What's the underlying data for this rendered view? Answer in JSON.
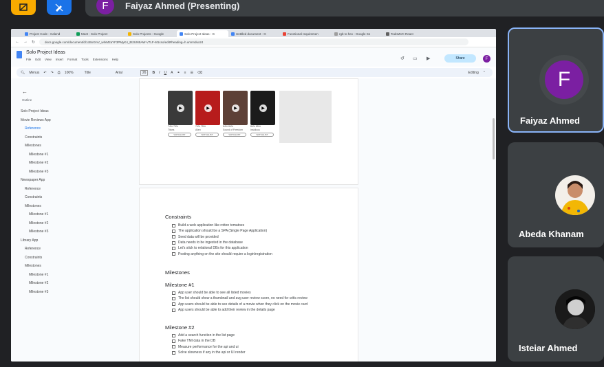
{
  "meet": {
    "presenter_initial": "F",
    "presenter_label": "Faiyaz Ahmed (Presenting)"
  },
  "browser": {
    "tabs": [
      {
        "title": "Project Code - Calend",
        "color": "#4285f4"
      },
      {
        "title": "Meet - Solo Project",
        "color": "#0f9d58"
      },
      {
        "title": "Solo Projects - Google",
        "color": "#f4b400"
      },
      {
        "title": "Solo Project Ideas - G",
        "color": "#4285f4",
        "active": true
      },
      {
        "title": "Untitled document - G",
        "color": "#4285f4"
      },
      {
        "title": "Functional requiremen",
        "color": "#ea4335"
      },
      {
        "title": "rgb to hex - Google Se",
        "color": "#9e9e9e"
      },
      {
        "title": "TodoMVC React",
        "color": "#616161"
      }
    ],
    "url": "docs.google.com/document/d/1cBxXmV_wrkM2aYF3PMyK4_BtJUNBAW-V7LF-M1cso/edit#heading=h.umnndux24"
  },
  "doc": {
    "title": "Solo Project Ideas",
    "menus": [
      "File",
      "Edit",
      "View",
      "Insert",
      "Format",
      "Tools",
      "Extensions",
      "Help"
    ],
    "share_label": "Share",
    "user_initial": "F",
    "toolbar": {
      "search": "Menus",
      "zoom": "100%",
      "style": "Title",
      "font": "Arial",
      "size": "26",
      "mode": "Editing"
    },
    "outline": [
      {
        "text": "Solo Project Ideas",
        "level": 0
      },
      {
        "text": "Movie Reviews App",
        "level": 0
      },
      {
        "text": "Reference",
        "level": 1,
        "active": true
      },
      {
        "text": "Constraints",
        "level": 1
      },
      {
        "text": "Milestones",
        "level": 1
      },
      {
        "text": "Milestone #1",
        "level": 2
      },
      {
        "text": "Milestone #2",
        "level": 2
      },
      {
        "text": "Milestone #3",
        "level": 2
      },
      {
        "text": "Newspaper App",
        "level": 0
      },
      {
        "text": "Reference",
        "level": 1
      },
      {
        "text": "Constraints",
        "level": 1
      },
      {
        "text": "Milestones",
        "level": 1
      },
      {
        "text": "Milestone #1",
        "level": 2
      },
      {
        "text": "Milestone #2",
        "level": 2
      },
      {
        "text": "Milestone #3",
        "level": 2
      },
      {
        "text": "Library App",
        "level": 0
      },
      {
        "text": "Reference",
        "level": 1
      },
      {
        "text": "Constraints",
        "level": 1
      },
      {
        "text": "Milestones",
        "level": 1
      },
      {
        "text": "Milestone #1",
        "level": 2
      },
      {
        "text": "Milestone #2",
        "level": 2
      },
      {
        "text": "Milestone #3",
        "level": 2
      }
    ],
    "outline_back_label": "Outline",
    "movies": [
      {
        "color": "#3a3a3a",
        "rating": "74% 75%",
        "name": "Titans",
        "btn": "WATCHLIST"
      },
      {
        "color": "#b71c1c",
        "rating": "74% 75%",
        "name": "Alien",
        "btn": "WATCHLIST"
      },
      {
        "color": "#5d4037",
        "rating": "84% 84%",
        "name": "Sound of Freedom",
        "btn": "WATCHLIST"
      },
      {
        "color": "#1b1b1b",
        "rating": "84% 85%",
        "name": "Insidious",
        "btn": "WATCHLIST"
      }
    ],
    "constraints_heading": "Constraints",
    "constraints": [
      "Build a web application like rotten tomatoes",
      "The application should be a SPA (Single Page Application)",
      "Seed data will be provided",
      "Data needs to be ingested in the database",
      "Let's stick to relational DBs for this application",
      "Posting anything on the site should require a login/registration"
    ],
    "milestones_heading": "Milestones",
    "m1_heading": "Milestone #1",
    "m1": [
      "App user should be able to see all listed movies",
      "The list should show a thumbnail and avg user review score, no need for critic review",
      "App users should be able to see details of a movie when they click on the movie card",
      "App users should be able to add their review in the details page"
    ],
    "m2_heading": "Milestone #2",
    "m2": [
      "Add a search function in the list page",
      "Fake TMI data in the DB",
      "Measure performance for the api and ui",
      "Solve slowness if any in the api or UI render"
    ]
  },
  "participants": [
    {
      "name": "Faiyaz Ahmed",
      "initial": "F",
      "selected": true
    },
    {
      "name": "Abeda Khanam"
    },
    {
      "name": "Isteiar Ahmed"
    }
  ],
  "colors": {
    "meet_bg": "#202124",
    "tile_bg": "#3c4043",
    "accent": "#8ab4f8",
    "avatar_purple": "#7b1fa2",
    "hand_button": "#f9ab00",
    "pen_button": "#1a73e8"
  }
}
